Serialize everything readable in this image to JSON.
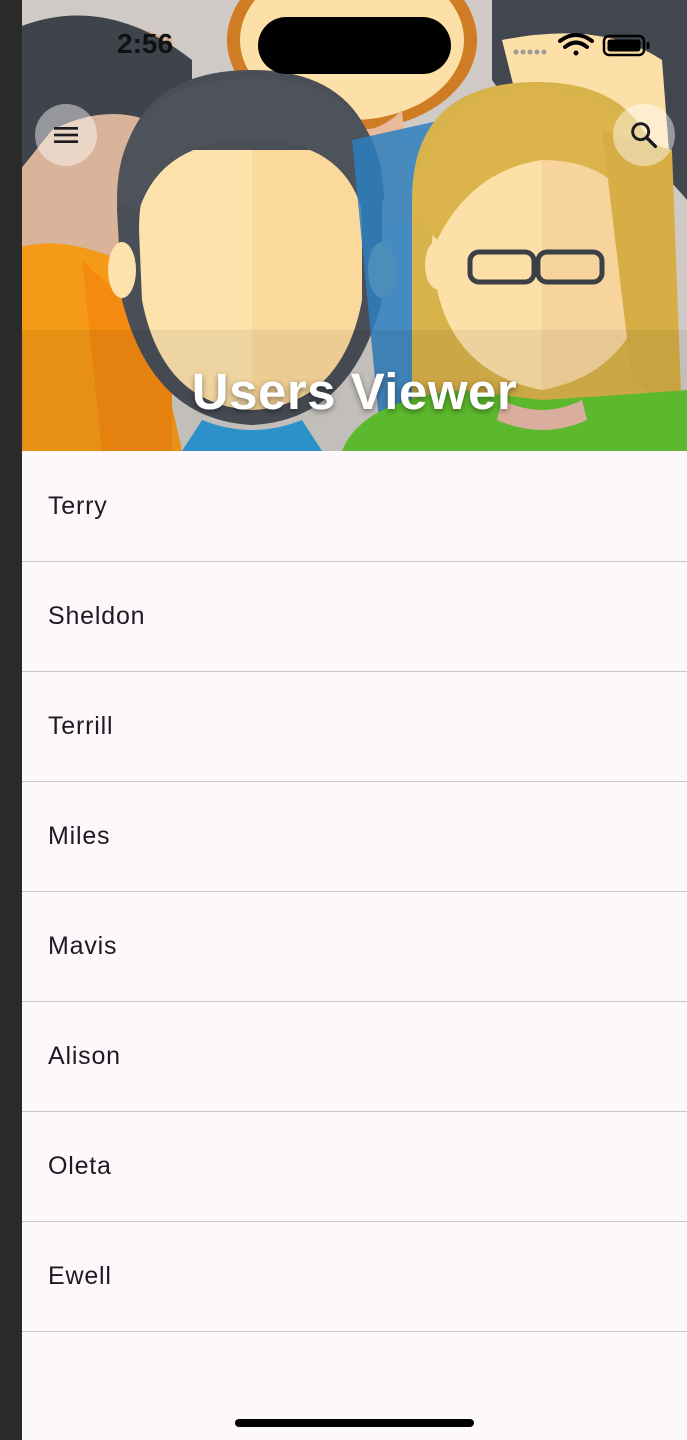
{
  "status_bar": {
    "time": "2:56"
  },
  "header": {
    "title": "Users Viewer",
    "menu_icon": "menu-icon",
    "search_icon": "search-icon"
  },
  "users": [
    {
      "name": "Terry"
    },
    {
      "name": "Sheldon"
    },
    {
      "name": "Terrill"
    },
    {
      "name": "Miles"
    },
    {
      "name": "Mavis"
    },
    {
      "name": "Alison"
    },
    {
      "name": "Oleta"
    },
    {
      "name": "Ewell"
    }
  ],
  "colors": {
    "list_background": "#fdf8fc",
    "divider": "#c9c6cb",
    "text": "#1d1b20"
  }
}
